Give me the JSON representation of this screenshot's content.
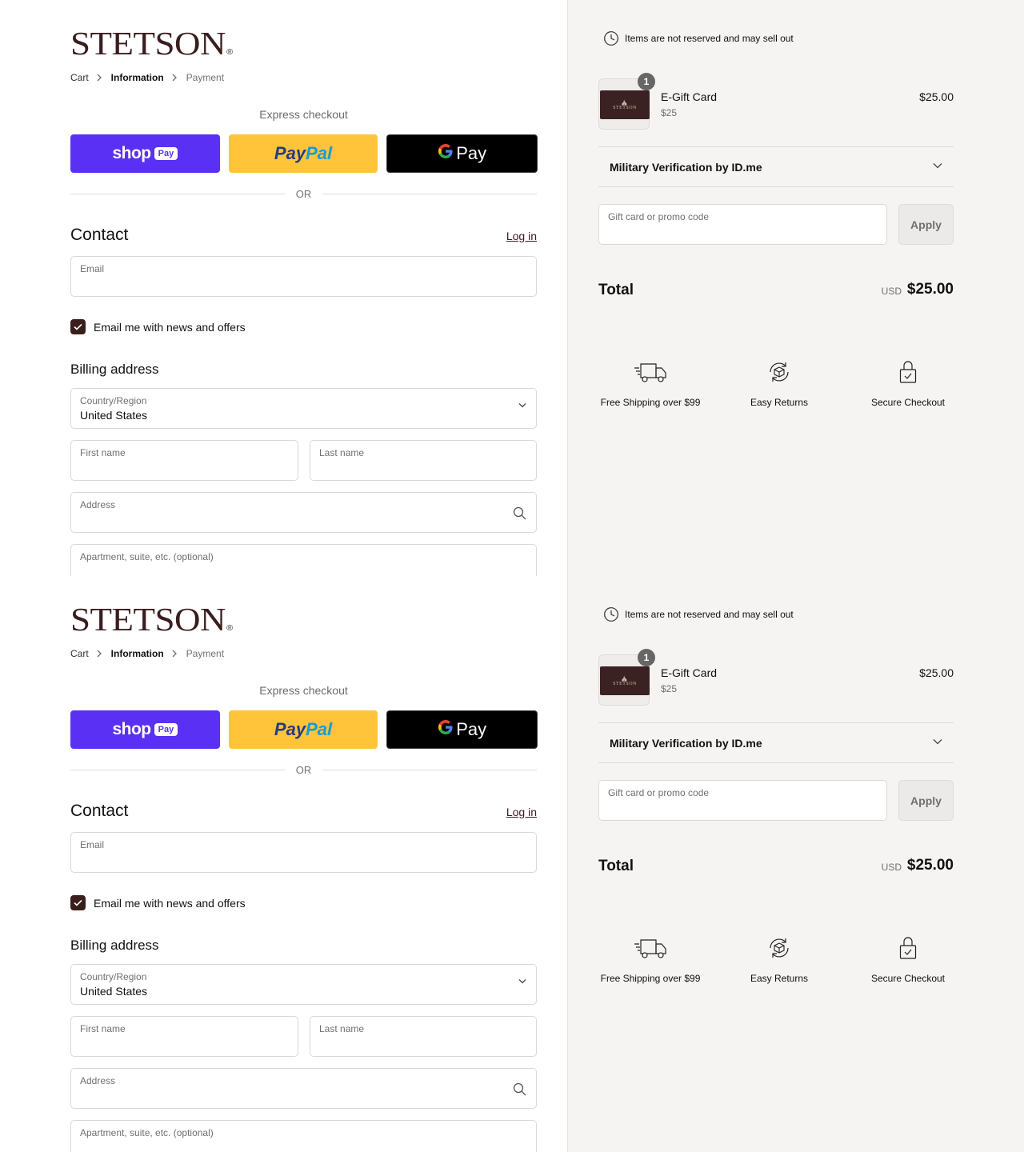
{
  "brand": {
    "logo_text": "STETSON",
    "registered": "®"
  },
  "breadcrumb": {
    "cart": "Cart",
    "information": "Information",
    "payment": "Payment"
  },
  "express": {
    "label": "Express checkout",
    "shop_word": "shop",
    "shop_pay": "Pay",
    "paypal_1": "Pay",
    "paypal_2": "Pal",
    "gpay_g": "G",
    "gpay_pay": "Pay",
    "or": "OR"
  },
  "contact": {
    "title": "Contact",
    "login": "Log in",
    "email_label": "Email",
    "news_checkbox": "Email me with news and offers",
    "news_checked": true
  },
  "billing": {
    "title": "Billing address",
    "country_label": "Country/Region",
    "country_value": "United States",
    "first_name_label": "First name",
    "last_name_label": "Last name",
    "address_label": "Address",
    "apartment_label": "Apartment, suite, etc. (optional)"
  },
  "summary": {
    "notice": "Items are not reserved and may sell out",
    "item": {
      "name": "E-Gift Card",
      "variant": "$25",
      "price": "$25.00",
      "quantity": "1",
      "card_text": "STETSON"
    },
    "military": "Military Verification by ID.me",
    "promo_label": "Gift card or promo code",
    "apply": "Apply",
    "total_label": "Total",
    "currency": "USD",
    "total": "$25.00"
  },
  "features": [
    {
      "label": "Free Shipping over $99",
      "icon": "truck-icon"
    },
    {
      "label": "Easy Returns",
      "icon": "returns-icon"
    },
    {
      "label": "Secure Checkout",
      "icon": "lock-icon"
    }
  ],
  "colors": {
    "brand": "#3a1d1d",
    "shop_pay": "#5a31f4",
    "paypal": "#ffc439",
    "gpay": "#000000",
    "summary_bg": "#f5f4f2"
  }
}
